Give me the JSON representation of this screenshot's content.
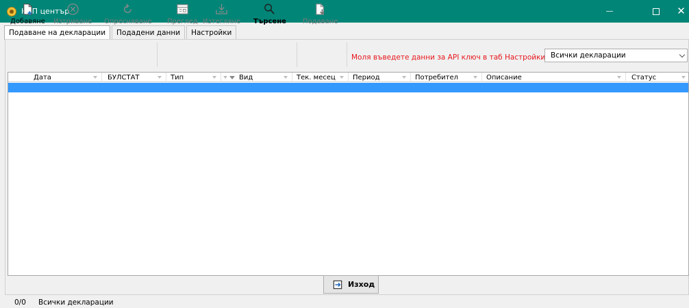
{
  "window": {
    "title": "НАП център",
    "icon": "coin-icon"
  },
  "tabs": [
    {
      "label": "Подаване на декларации",
      "active": true
    },
    {
      "label": "Подадени данни",
      "active": false
    },
    {
      "label": "Настройки",
      "active": false
    }
  ],
  "toolbar": {
    "add": {
      "label": "Добавяне",
      "enabled": true,
      "icon": "add-document-icon"
    },
    "delete": {
      "label": "Изтриване",
      "enabled": false,
      "icon": "circle-x-icon"
    },
    "refresh": {
      "label": "Опресняване",
      "enabled": false,
      "icon": "refresh-icon"
    },
    "preview": {
      "label": "Преглед",
      "enabled": false,
      "icon": "preview-icon"
    },
    "download": {
      "label": "Изтегляне",
      "enabled": false,
      "icon": "download-icon"
    },
    "search": {
      "label": "Търсене",
      "enabled": true,
      "icon": "search-icon"
    },
    "submit": {
      "label": "Подаване",
      "enabled": false,
      "icon": "submit-icon"
    }
  },
  "warning": {
    "text": "Моля въведете данни за API ключ в таб Настройки.",
    "color": "#e8161c"
  },
  "filter": {
    "selected": "Всички декларации",
    "icon": "chevron-down-icon"
  },
  "grid": {
    "columns": [
      {
        "label": "Дата"
      },
      {
        "label": "БУЛСТАТ"
      },
      {
        "label": "Тип"
      },
      {
        "label": "Вид"
      },
      {
        "label": "Тек. месец"
      },
      {
        "label": "Период"
      },
      {
        "label": "Потребител"
      },
      {
        "label": "Описание"
      },
      {
        "label": "Статус"
      }
    ],
    "selected_row_color": "#3399ff"
  },
  "exit_button": {
    "label": "Изход",
    "icon": "exit-icon"
  },
  "statusbar": {
    "count": "0/0",
    "text": "Всички декларации"
  },
  "colors": {
    "title_bar": "#008577"
  }
}
